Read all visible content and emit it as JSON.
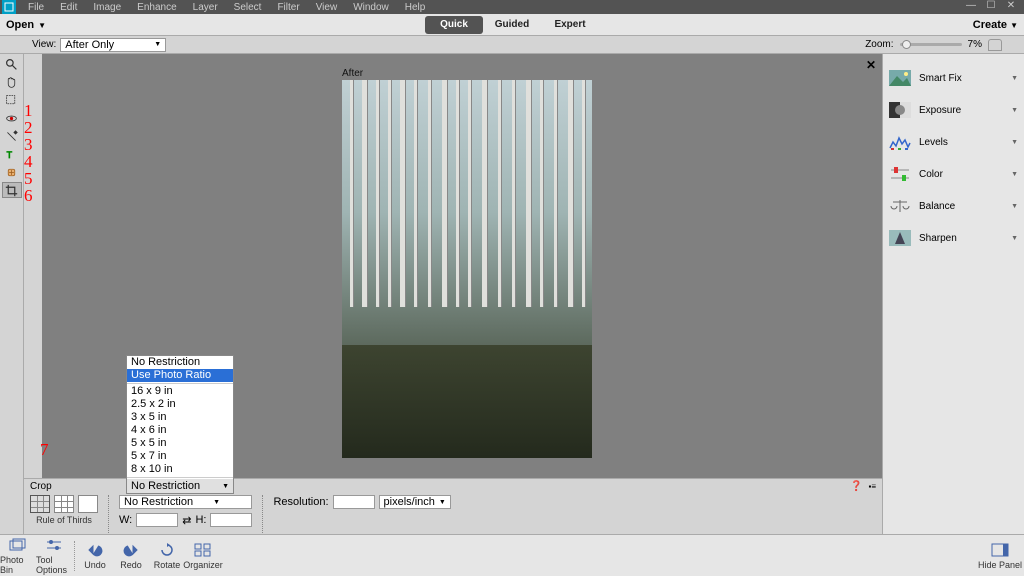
{
  "menubar": {
    "items": [
      "File",
      "Edit",
      "Image",
      "Enhance",
      "Layer",
      "Select",
      "Filter",
      "View",
      "Window",
      "Help"
    ]
  },
  "topbar": {
    "open": "Open",
    "tabs": [
      {
        "label": "Quick",
        "selected": true
      },
      {
        "label": "Guided",
        "selected": false
      },
      {
        "label": "Expert",
        "selected": false
      }
    ],
    "create": "Create"
  },
  "viewbar": {
    "view_label": "View:",
    "view_value": "After Only",
    "zoom_label": "Zoom:",
    "zoom_value": "7%"
  },
  "canvas": {
    "after_label": "After"
  },
  "annotations": [
    "1",
    "2",
    "3",
    "4",
    "5",
    "6"
  ],
  "annotation_bottom": "7",
  "adjustments": [
    {
      "label": "Smart Fix",
      "icon": "smartfix"
    },
    {
      "label": "Exposure",
      "icon": "exposure"
    },
    {
      "label": "Levels",
      "icon": "levels"
    },
    {
      "label": "Color",
      "icon": "color"
    },
    {
      "label": "Balance",
      "icon": "balance"
    },
    {
      "label": "Sharpen",
      "icon": "sharpen"
    }
  ],
  "options": {
    "title": "Crop",
    "rule_caption": "Rule of Thirds",
    "w_label": "W:",
    "h_label": "H:",
    "res_label": "Resolution:",
    "res_unit": "pixels/inch",
    "aspect_selected": "No Restriction"
  },
  "crop_presets": {
    "items": [
      "No Restriction",
      "Use Photo Ratio",
      "16 x 9 in",
      "2.5 x 2 in",
      "3 x 5 in",
      "4 x 6 in",
      "5 x 5 in",
      "5 x 7 in",
      "8 x 10 in"
    ],
    "highlighted_index": 1,
    "footer_selected": "No Restriction"
  },
  "footbar": {
    "buttons": [
      {
        "label": "Photo Bin",
        "icon": "photobin"
      },
      {
        "label": "Tool Options",
        "icon": "tool-options"
      },
      {
        "label": "Undo",
        "icon": "undo"
      },
      {
        "label": "Redo",
        "icon": "redo"
      },
      {
        "label": "Rotate",
        "icon": "rotate"
      },
      {
        "label": "Organizer",
        "icon": "organizer"
      }
    ],
    "hide_panel": "Hide Panel"
  }
}
